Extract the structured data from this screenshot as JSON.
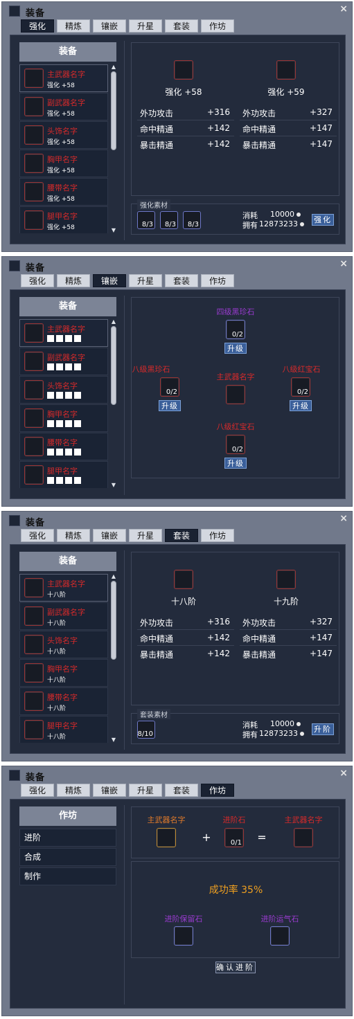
{
  "window_title": "装备",
  "close_symbol": "×",
  "tabs": [
    "强化",
    "精炼",
    "镶嵌",
    "升星",
    "套装",
    "作坊"
  ],
  "equip_panel_title": "装备",
  "equipment": [
    "主武器名字",
    "副武器名字",
    "头饰名字",
    "胸甲名字",
    "腰带名字",
    "腿甲名字"
  ],
  "scroll": {
    "up": "▲",
    "down": "▼"
  },
  "strengthen": {
    "active_tab": "强化",
    "level_suffix": "强化 +58",
    "cur_label": "强化 +58",
    "next_label": "强化 +59",
    "stats_left": [
      {
        "name": "外功攻击",
        "value": "+316"
      },
      {
        "name": "命中精通",
        "value": "+142"
      },
      {
        "name": "暴击精通",
        "value": "+142"
      }
    ],
    "stats_right": [
      {
        "name": "外功攻击",
        "value": "+327"
      },
      {
        "name": "命中精通",
        "value": "+147"
      },
      {
        "name": "暴击精通",
        "value": "+147"
      }
    ],
    "materials_title": "强化素材",
    "materials": [
      "8/3",
      "8/3",
      "8/3"
    ],
    "cost_label": "消耗",
    "cost_value": "10000",
    "own_label": "拥有",
    "own_value": "12873233",
    "button": "强化"
  },
  "inlay": {
    "active_tab": "镶嵌",
    "top_gem": "四级黑珍石",
    "left_gem": "八级黑珍石",
    "right_gem": "八级红宝石",
    "bottom_gem": "八级红宝石",
    "center_name": "主武器名字",
    "gem_count": "0/2",
    "upgrade_button": "升级"
  },
  "suit": {
    "active_tab": "套装",
    "level_suffix": "十八阶",
    "cur_label": "十八阶",
    "next_label": "十九阶",
    "stats_left": [
      {
        "name": "外功攻击",
        "value": "+316"
      },
      {
        "name": "命中精通",
        "value": "+142"
      },
      {
        "name": "暴击精通",
        "value": "+142"
      }
    ],
    "stats_right": [
      {
        "name": "外功攻击",
        "value": "+327"
      },
      {
        "name": "命中精通",
        "value": "+147"
      },
      {
        "name": "暴击精通",
        "value": "+147"
      }
    ],
    "materials_title": "套装素材",
    "materials": [
      "8/10"
    ],
    "cost_label": "消耗",
    "cost_value": "10000",
    "own_label": "拥有",
    "own_value": "12873233",
    "button": "升阶"
  },
  "workshop": {
    "active_tab": "作坊",
    "panel_title": "作坊",
    "menu": [
      "进阶",
      "合成",
      "制作"
    ],
    "input_item": "主武器名字",
    "plus": "+",
    "stone": "进阶石",
    "stone_count": "0/1",
    "equals": "=",
    "output_item": "主武器名字",
    "success_rate": "成功率 35%",
    "protect_stone": "进阶保留石",
    "luck_stone": "进阶运气石",
    "confirm_button": "确认进阶"
  }
}
